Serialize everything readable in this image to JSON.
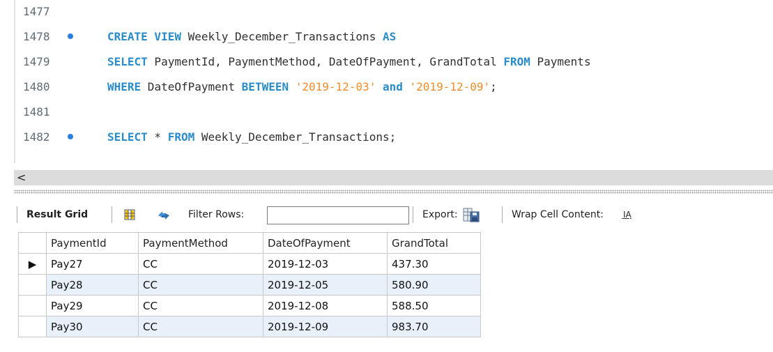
{
  "editor": {
    "lines": [
      {
        "number": "1477",
        "breakpoint": false,
        "tokens": []
      },
      {
        "number": "1478",
        "breakpoint": true,
        "tokens": [
          {
            "t": "kw",
            "v": "CREATE VIEW"
          },
          {
            "t": "plain",
            "v": " Weekly_December_Transactions "
          },
          {
            "t": "kw",
            "v": "AS"
          }
        ]
      },
      {
        "number": "1479",
        "breakpoint": false,
        "tokens": [
          {
            "t": "kw",
            "v": "SELECT"
          },
          {
            "t": "plain",
            "v": " PaymentId, PaymentMethod, DateOfPayment, GrandTotal "
          },
          {
            "t": "kw",
            "v": "FROM"
          },
          {
            "t": "plain",
            "v": " Payments"
          }
        ]
      },
      {
        "number": "1480",
        "breakpoint": false,
        "tokens": [
          {
            "t": "kw",
            "v": "WHERE"
          },
          {
            "t": "plain",
            "v": " DateOfPayment "
          },
          {
            "t": "kw",
            "v": "BETWEEN"
          },
          {
            "t": "plain",
            "v": " "
          },
          {
            "t": "str",
            "v": "'2019-12-03'"
          },
          {
            "t": "plain",
            "v": " "
          },
          {
            "t": "kw",
            "v": "and"
          },
          {
            "t": "plain",
            "v": " "
          },
          {
            "t": "str",
            "v": "'2019-12-09'"
          },
          {
            "t": "plain",
            "v": ";"
          }
        ]
      },
      {
        "number": "1481",
        "breakpoint": false,
        "tokens": []
      },
      {
        "number": "1482",
        "breakpoint": true,
        "tokens": [
          {
            "t": "kw",
            "v": "SELECT"
          },
          {
            "t": "plain",
            "v": " * "
          },
          {
            "t": "kw",
            "v": "FROM"
          },
          {
            "t": "plain",
            "v": " Weekly_December_Transactions;"
          }
        ]
      }
    ],
    "scroll_left_arrow": "<"
  },
  "toolbar": {
    "result_grid_label": "Result Grid",
    "filter_label": "Filter Rows:",
    "filter_value": "",
    "export_label": "Export:",
    "wrap_label": "Wrap Cell Content:",
    "wrap_icon_text": "I͟A",
    "icons": [
      "grid-icon",
      "refresh-icon",
      "export-icon",
      "wrap-icon"
    ]
  },
  "grid": {
    "columns": [
      "PaymentId",
      "PaymentMethod",
      "DateOfPayment",
      "GrandTotal"
    ],
    "current_row_marker": "▶",
    "rows": [
      [
        "Pay27",
        "CC",
        "2019-12-03",
        "437.30"
      ],
      [
        "Pay28",
        "CC",
        "2019-12-05",
        "580.90"
      ],
      [
        "Pay29",
        "CC",
        "2019-12-08",
        "588.50"
      ],
      [
        "Pay30",
        "CC",
        "2019-12-09",
        "983.70"
      ]
    ]
  },
  "colors": {
    "keyword": "#2a8cc9",
    "string": "#f28c28",
    "breakpoint": "#2a7fdf",
    "alt_row": "#e8f0fa"
  }
}
